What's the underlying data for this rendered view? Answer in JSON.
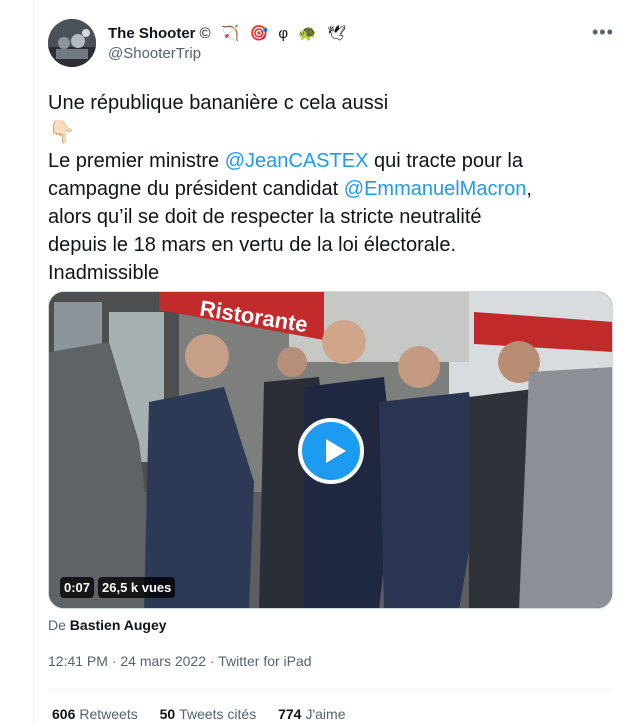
{
  "author": {
    "name": "The Shooter",
    "emoji_suffix": "© 🏹 🎯 φ 🐢 🕊",
    "handle": "@ShooterTrip"
  },
  "more_icon": "more-dots-icon",
  "tweet_text": {
    "line1": "Une république bananière c cela aussi",
    "emoji": "👇🏻",
    "line2_before": "Le premier ministre ",
    "mention1": "@JeanCASTEX",
    "line2_after": " qui tracte pour la",
    "line3_before": "campagne du président candidat ",
    "mention2": "@EmmanuelMacron",
    "line3_after": ",",
    "line4": "alors qu’il se doit de respecter la stricte neutralité",
    "line5": "depuis le 18 mars en vertu de la loi électorale.",
    "line6": "Inadmissible"
  },
  "video": {
    "sign_text": "Ristorante",
    "duration": "0:07",
    "views": "26,5 k vues",
    "play_icon": "play-icon"
  },
  "attribution": {
    "prefix": "De",
    "name": "Bastien Augey"
  },
  "meta": {
    "time": "12:41 PM",
    "separator1": "·",
    "date": "24 mars 2022",
    "separator2": "·",
    "source": "Twitter for iPad"
  },
  "stats": {
    "retweets_count": "606",
    "retweets_label": "Retweets",
    "quotes_count": "50",
    "quotes_label": "Tweets cités",
    "likes_count": "774",
    "likes_label": "J'aime"
  },
  "colors": {
    "accent": "#1d9bf0",
    "text": "#0f1419",
    "secondary": "#536471",
    "border": "#eff3f4"
  }
}
